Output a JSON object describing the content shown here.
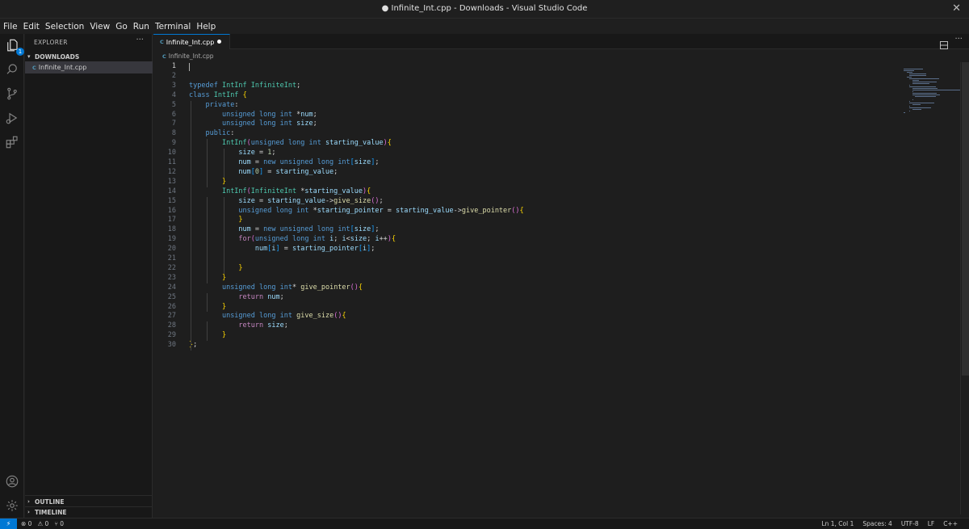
{
  "window": {
    "title": "● Infinite_Int.cpp - Downloads - Visual Studio Code",
    "close_glyph": "✕"
  },
  "menu": [
    "File",
    "Edit",
    "Selection",
    "View",
    "Go",
    "Run",
    "Terminal",
    "Help"
  ],
  "activity": {
    "explorer_badge": "1"
  },
  "sidebar": {
    "header": "EXPLORER",
    "more": "···",
    "folder": "DOWNLOADS",
    "file": "Infinite_Int.cpp",
    "file_icon": "C",
    "outline": "OUTLINE",
    "timeline": "TIMELINE"
  },
  "editor": {
    "tab_label": "Infinite_Int.cpp",
    "tab_icon": "C",
    "breadcrumb": "Infinite_Int.cpp",
    "more": "···"
  },
  "code_lines": [
    "",
    "",
    "typedef IntInf InfiniteInt;",
    "class IntInf {",
    "    private:",
    "        unsigned long int *num;",
    "        unsigned long int size;",
    "    public:",
    "        IntInf(unsigned long int starting_value){",
    "            size = 1;",
    "            num = new unsigned long int[size];",
    "            num[0] = starting_value;",
    "        }",
    "        IntInf(InfiniteInt *starting_value){",
    "            size = starting_value->give_size();",
    "            unsigned long int *starting_pointer = starting_value->give_pointer(){",
    "            }",
    "            num = new unsigned long int[size];",
    "            for(unsigned long int i; i<size; i++){",
    "                num[i] = starting_pointer[i];",
    "",
    "            }",
    "        }",
    "        unsigned long int* give_pointer(){",
    "            return num;",
    "        }",
    "        unsigned long int give_size(){",
    "            return size;",
    "        }",
    "};"
  ],
  "status": {
    "remote_glyph": "⚡",
    "errors": "⊗ 0",
    "warnings": "⚠ 0",
    "ports": "⑂ 0",
    "position": "Ln 1, Col 1",
    "spaces": "Spaces: 4",
    "encoding": "UTF-8",
    "eol": "LF",
    "language": "C++"
  },
  "colors": {
    "accent": "#0078d4",
    "keyword": "#569cd6",
    "type": "#4ec9b0",
    "variable": "#9cdcfe",
    "function": "#dcdcaa",
    "number": "#b5cea8",
    "control": "#c586c0"
  }
}
